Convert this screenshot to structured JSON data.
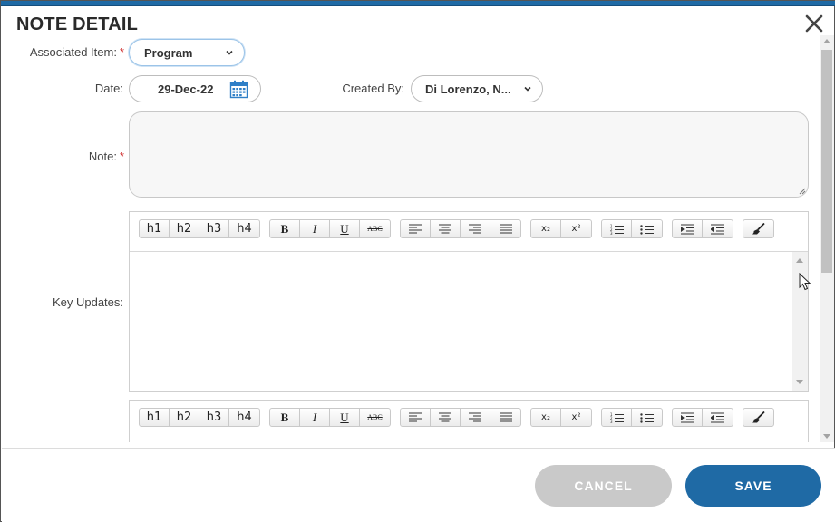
{
  "dialog": {
    "title": "NOTE DETAIL"
  },
  "form": {
    "associated_item": {
      "label": "Associated Item:",
      "required_mark": "*",
      "value": "Program"
    },
    "date": {
      "label": "Date:",
      "value": "29-Dec-22"
    },
    "created_by": {
      "label": "Created By:",
      "value": "Di Lorenzo, N..."
    },
    "note": {
      "label": "Note:",
      "required_mark": "*",
      "value": ""
    },
    "key_updates": {
      "label": "Key Updates:"
    }
  },
  "toolbar": {
    "headings": [
      "h1",
      "h2",
      "h3",
      "h4"
    ],
    "format": [
      "B",
      "I",
      "U",
      "ABC"
    ],
    "subsup": [
      "x₂",
      "x²"
    ]
  },
  "footer": {
    "cancel_label": "CANCEL",
    "save_label": "SAVE"
  },
  "colors": {
    "accent": "#1f6aa5",
    "required": "#d23a3a",
    "cancel_disabled": "#c9c9c9"
  }
}
